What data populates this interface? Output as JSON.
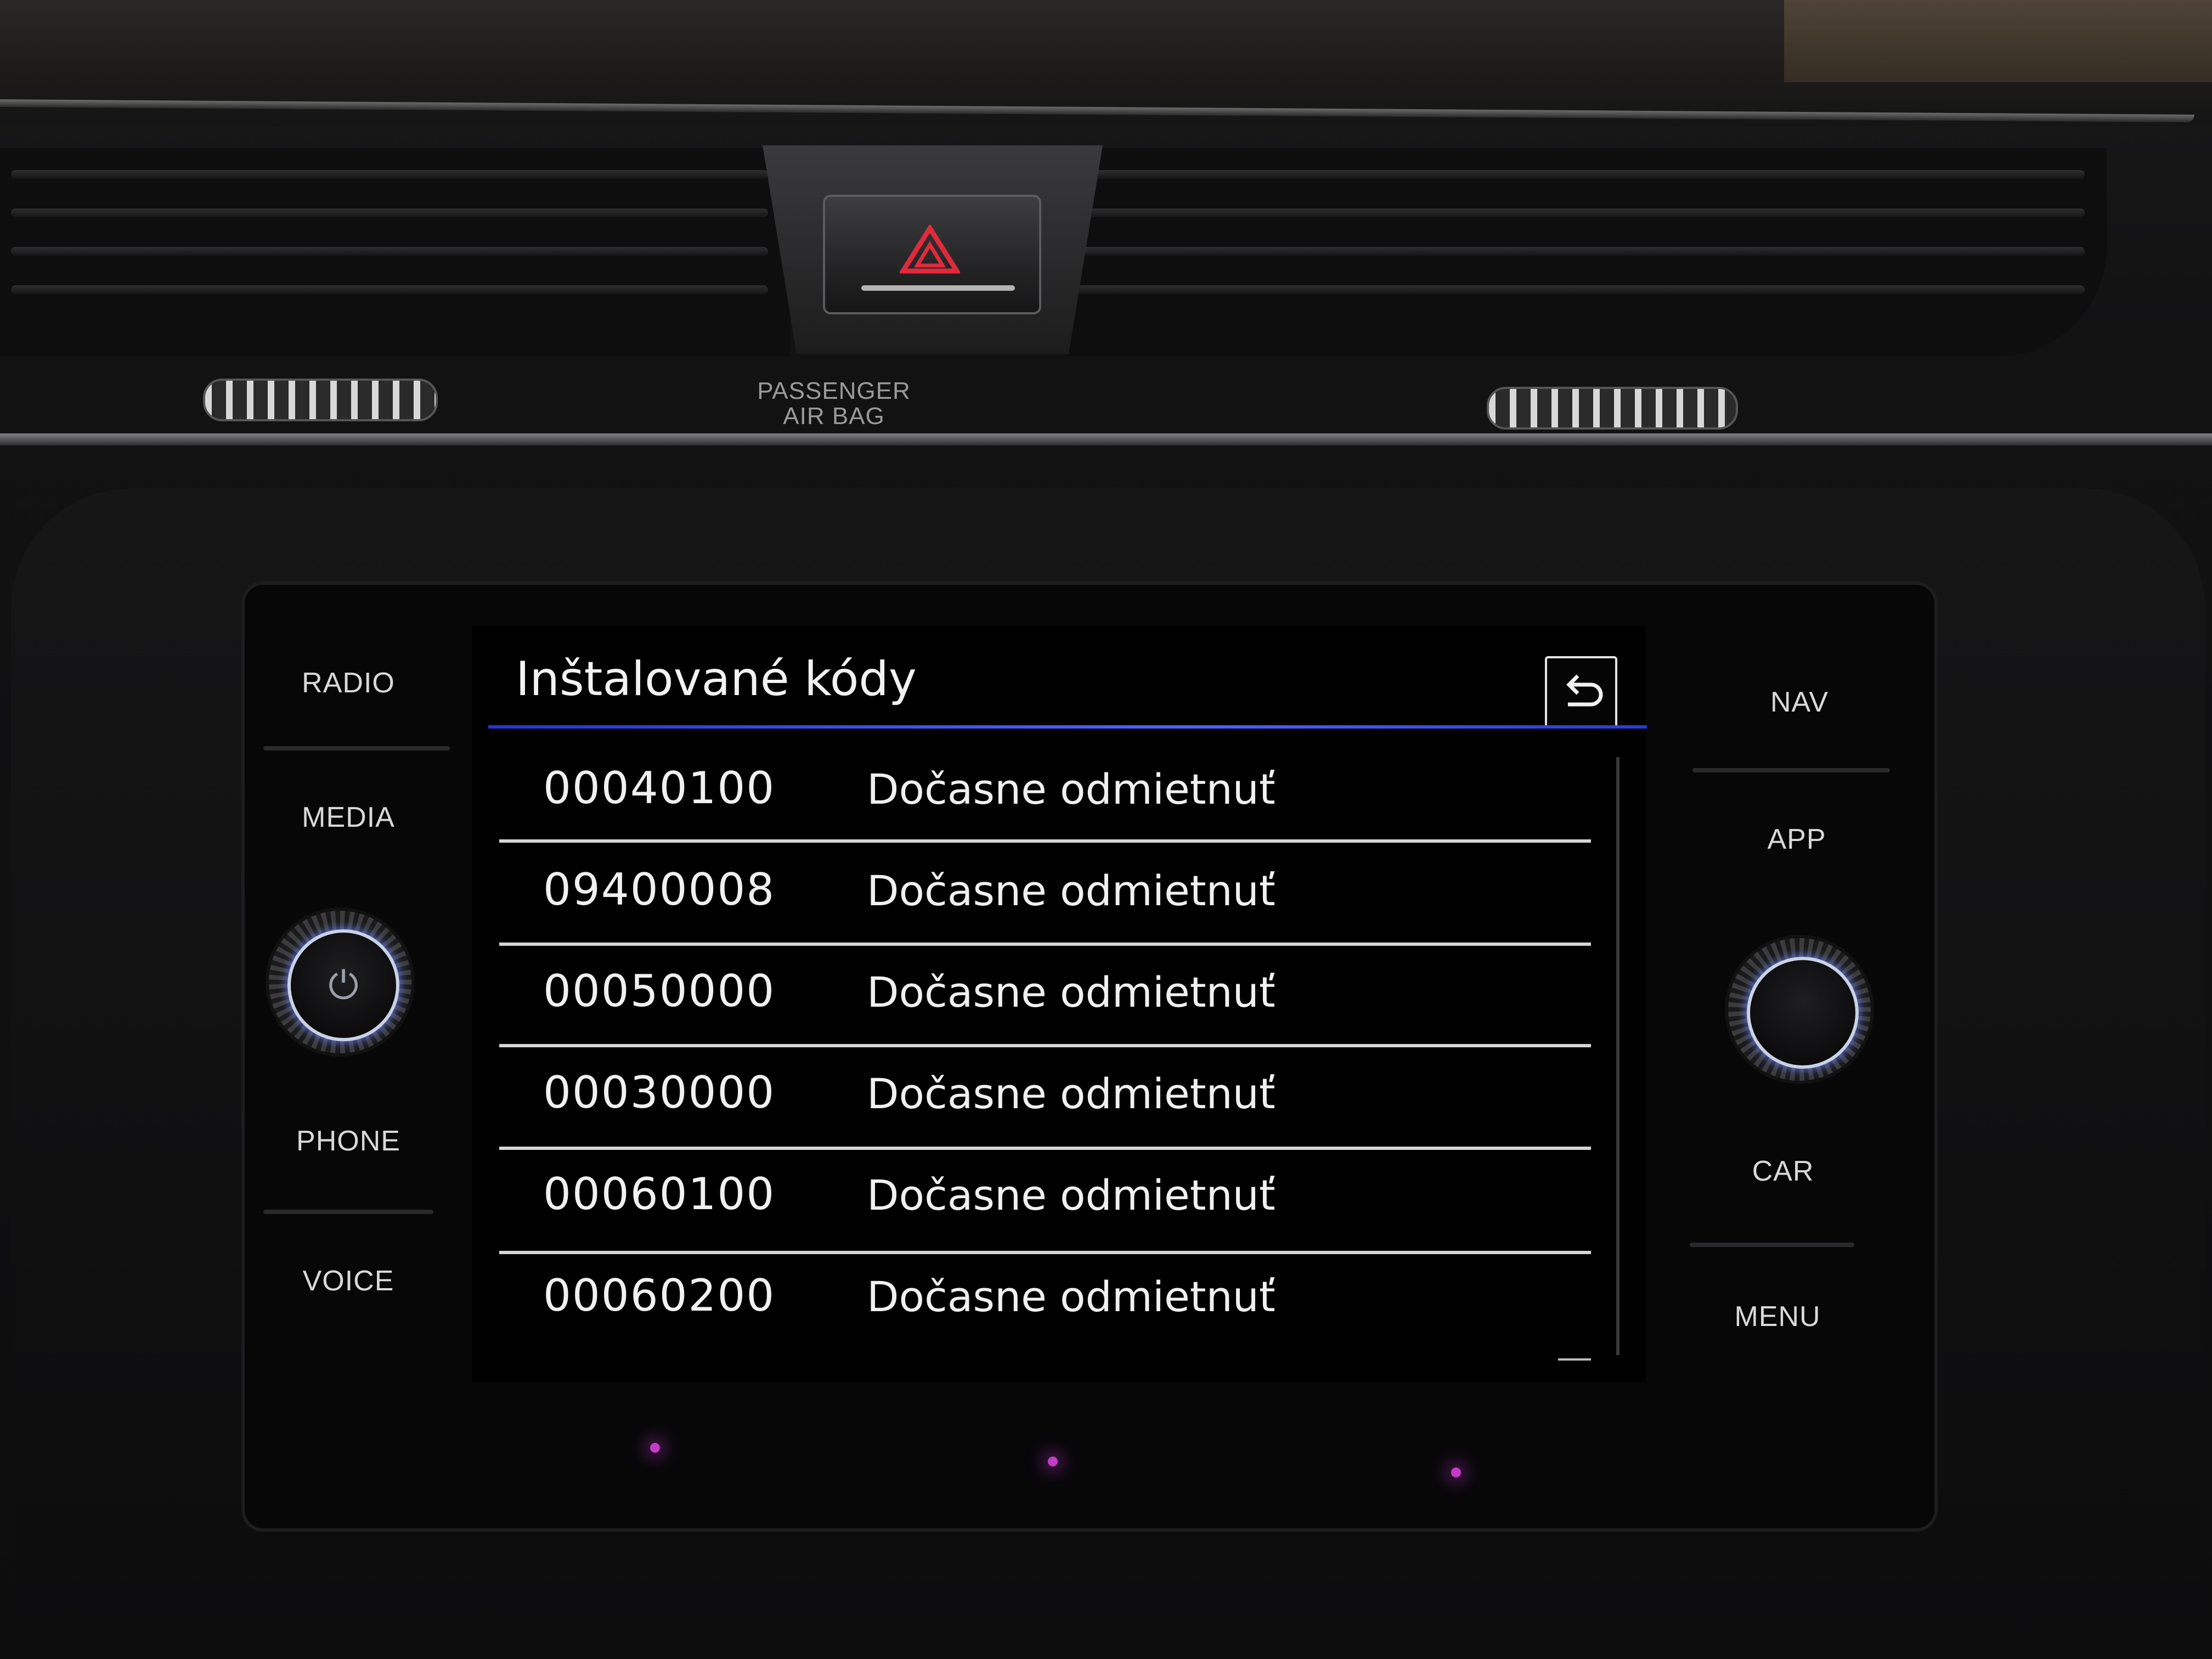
{
  "dashboard": {
    "airbag_label_line1": "PASSENGER",
    "airbag_label_line2": "AIR BAG",
    "hazard_color": "#e02a3a"
  },
  "hardkeys": {
    "left": [
      "RADIO",
      "MEDIA",
      "PHONE",
      "VOICE"
    ],
    "right": [
      "NAV",
      "APP",
      "CAR",
      "MENU"
    ]
  },
  "knobs": {
    "left_icon": "power-icon",
    "right_icon": "rotary-knob-icon",
    "ring_color": "#c9d2e6"
  },
  "screen": {
    "title": "Inštalované kódy",
    "back_icon": "back-arrow-icon",
    "accent_color": "#3f55ff",
    "rows": [
      {
        "code": "00040100",
        "status": "Dočasne odmietnuť"
      },
      {
        "code": "09400008",
        "status": "Dočasne odmietnuť"
      },
      {
        "code": "00050000",
        "status": "Dočasne odmietnuť"
      },
      {
        "code": "00030000",
        "status": "Dočasne odmietnuť"
      },
      {
        "code": "00060100",
        "status": "Dočasne odmietnuť"
      },
      {
        "code": "00060200",
        "status": "Dočasne odmietnuť"
      }
    ]
  }
}
